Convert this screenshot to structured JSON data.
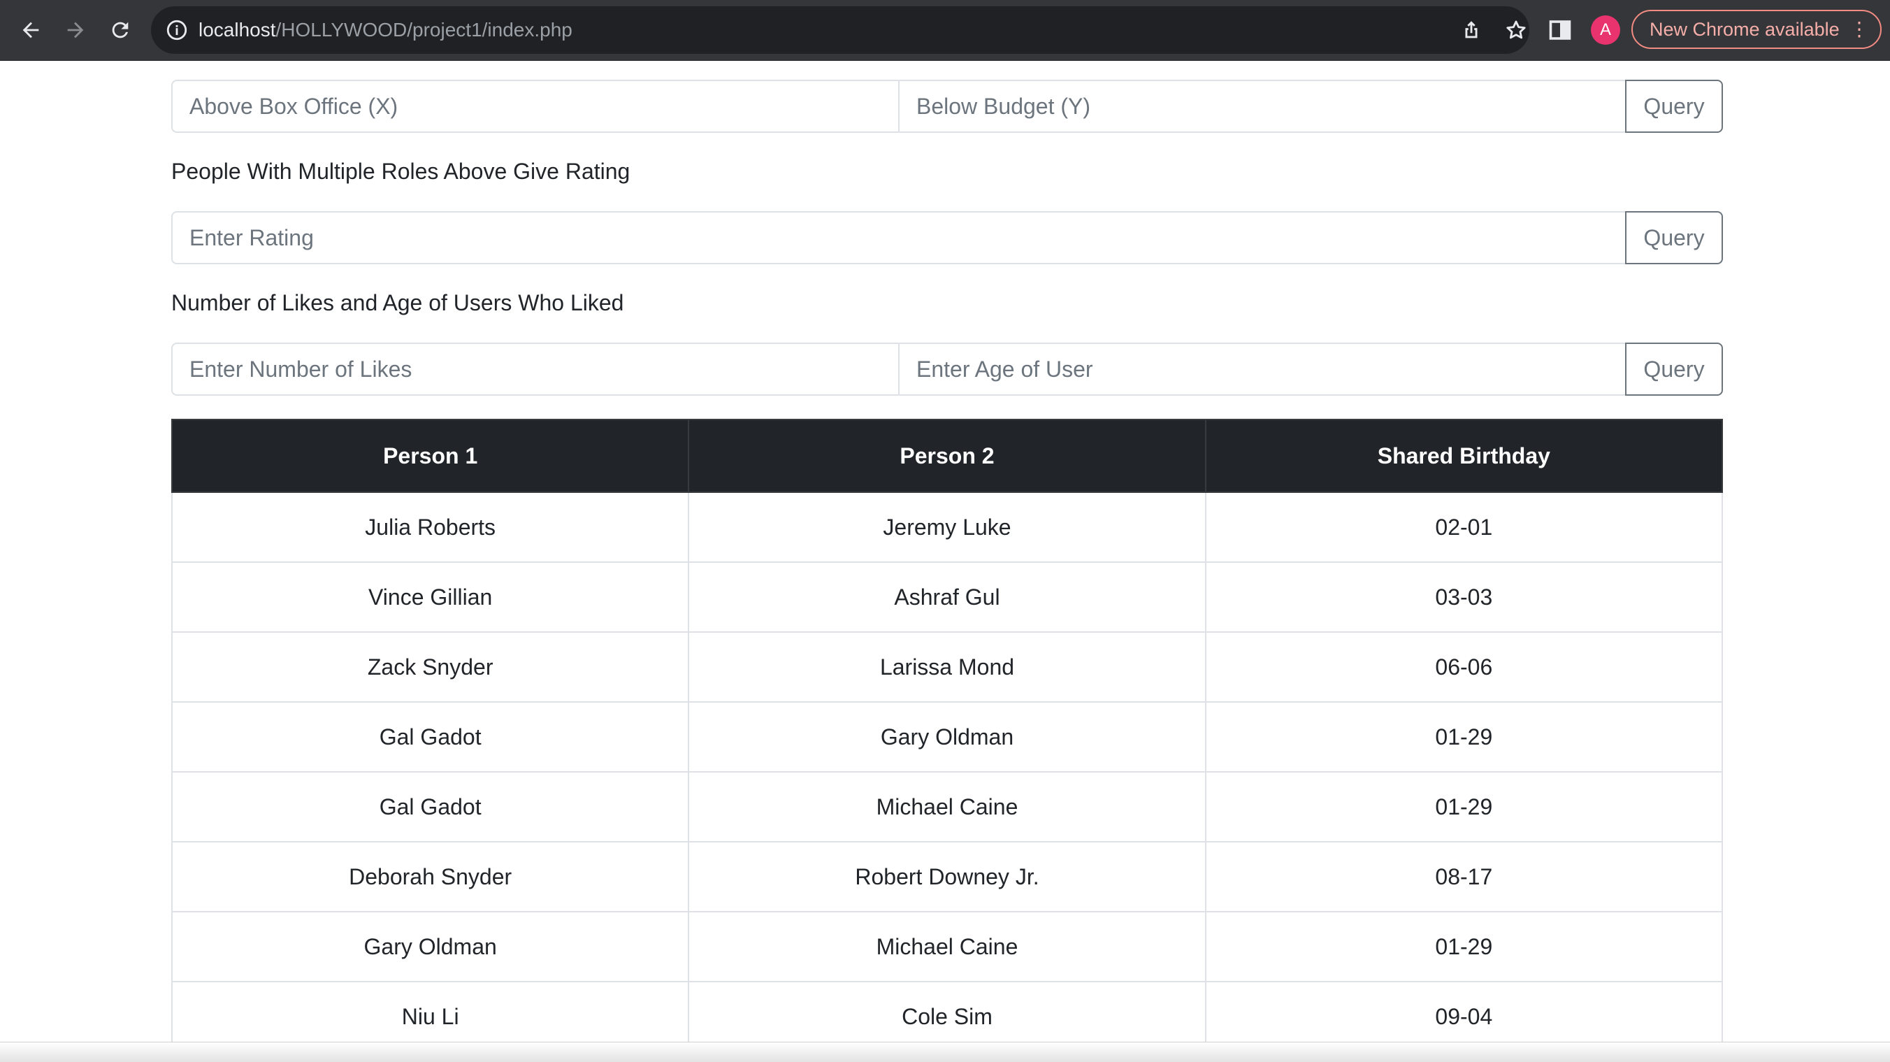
{
  "browser": {
    "url_host": "localhost",
    "url_path": "/HOLLYWOOD/project1/index.php",
    "profile_initial": "A",
    "update_label": "New Chrome available"
  },
  "form1": {
    "placeholder_x": "Above Box Office (X)",
    "placeholder_y": "Below Budget (Y)",
    "button": "Query"
  },
  "form2": {
    "label": "People With Multiple Roles Above Give Rating",
    "placeholder": "Enter Rating",
    "button": "Query"
  },
  "form3": {
    "label": "Number of Likes and Age of Users Who Liked",
    "placeholder_likes": "Enter Number of Likes",
    "placeholder_age": "Enter Age of User",
    "button": "Query"
  },
  "table": {
    "headers": [
      "Person 1",
      "Person 2",
      "Shared Birthday"
    ],
    "rows": [
      [
        "Julia Roberts",
        "Jeremy Luke",
        "02-01"
      ],
      [
        "Vince Gillian",
        "Ashraf Gul",
        "03-03"
      ],
      [
        "Zack Snyder",
        "Larissa Mond",
        "06-06"
      ],
      [
        "Gal Gadot",
        "Gary Oldman",
        "01-29"
      ],
      [
        "Gal Gadot",
        "Michael Caine",
        "01-29"
      ],
      [
        "Deborah Snyder",
        "Robert Downey Jr.",
        "08-17"
      ],
      [
        "Gary Oldman",
        "Michael Caine",
        "01-29"
      ],
      [
        "Niu Li",
        "Cole Sim",
        "09-04"
      ]
    ]
  }
}
